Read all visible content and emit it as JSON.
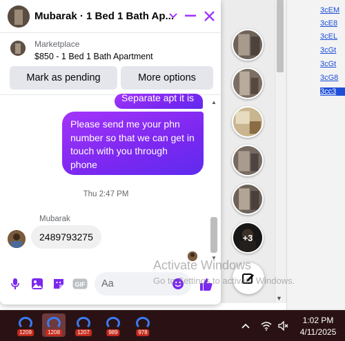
{
  "chat": {
    "title": "Mubarak · 1 Bed 1 Bath Ap...",
    "listing": {
      "category": "Marketplace",
      "price_title": "$850 - 1 Bed 1 Bath Apartment",
      "buttons": [
        "Mark as pending",
        "More options"
      ]
    },
    "messages": {
      "top_partial": "Separate apt it is",
      "outgoing": "Please send me your phn number so that we can get in touch with you through phone",
      "timestamp": "Thu 2:47 PM",
      "sender": "Mubarak",
      "incoming": "2489793275"
    },
    "composer": {
      "placeholder": "Aa"
    }
  },
  "side": {
    "more_count": "+3"
  },
  "background": {
    "links": [
      "3cEM",
      "3cE8",
      "3cEL",
      "3cGt",
      "3cGt",
      "3cG8",
      "3cc3"
    ]
  },
  "watermark": {
    "title": "Activate Windows",
    "subtitle": "Go to Settings to activate Windows."
  },
  "taskbar": {
    "badges": [
      "1209",
      "1208",
      "1207",
      "989",
      "978"
    ],
    "time": "1:02 PM",
    "date": "4/11/2025"
  },
  "colors": {
    "accent": "#a033ff",
    "bubble_gradient_end": "#5f2bef",
    "header_icon": "#a033ff",
    "taskbar_bg": "#2a1214"
  }
}
